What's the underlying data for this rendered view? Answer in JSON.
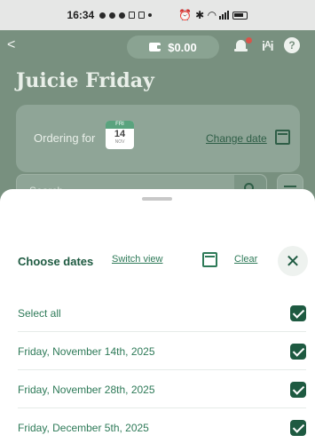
{
  "status_bar": {
    "time": "16:34"
  },
  "header": {
    "back_label": "<",
    "wallet_amount": "$0.00",
    "help_label": "?",
    "title": "Juicie Friday"
  },
  "ordering_card": {
    "label": "Ordering for",
    "calendar_day": "14",
    "calendar_top": "FRI",
    "calendar_month": "NOV",
    "change_link": "Change date"
  },
  "search": {
    "placeholder": "Search"
  },
  "sheet": {
    "title": "Choose dates",
    "switch_view": "Switch view",
    "clear": "Clear",
    "close_label": "✕",
    "rows": [
      {
        "label": "Select all",
        "checked": true
      },
      {
        "label": "Friday, November 14th, 2025",
        "checked": true
      },
      {
        "label": "Friday, November 28th, 2025",
        "checked": true
      },
      {
        "label": "Friday, December 5th, 2025",
        "checked": true
      }
    ]
  },
  "colors": {
    "accent": "#1e5a41",
    "link": "#2e7a58",
    "overlay": "#78907f"
  }
}
